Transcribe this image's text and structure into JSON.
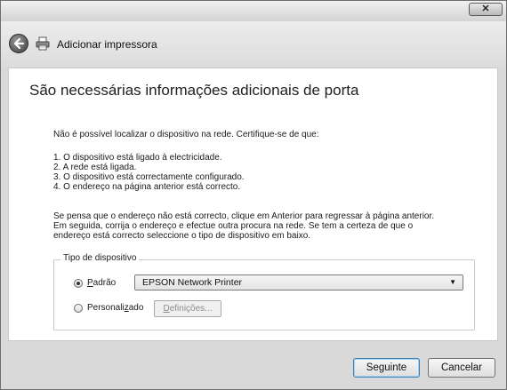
{
  "window": {
    "title": "Adicionar impressora",
    "close_label": "✕"
  },
  "page": {
    "heading": "São necessárias informações adicionais de porta",
    "not_found": "Não é possível localizar o dispositivo na rede. Certifique-se de que:",
    "checklist": [
      "1. O dispositivo está ligado à electricidade.",
      "2. A rede está ligada.",
      "3. O dispositivo está correctamente configurado.",
      "4. O endereço na página anterior está correcto."
    ],
    "hint_lines": [
      "Se pensa que o endereço não está correcto, clique em Anterior para regressar à página anterior.",
      "Em seguida, corrija o endereço e efectue outra procura na rede. Se tem a certeza de que o",
      "endereço está correcto seleccione o tipo de dispositivo em baixo."
    ]
  },
  "device_type": {
    "group_label": "Tipo de dispositivo",
    "standard": {
      "accel": "P",
      "rest": "adrão",
      "checked": true
    },
    "custom": {
      "before": "Personali",
      "accel": "z",
      "after": "ado",
      "checked": false
    },
    "standard_selected": "EPSON Network Printer",
    "settings_button": {
      "accel": "D",
      "rest": "efinições...",
      "enabled": false
    }
  },
  "footer": {
    "next_label": "Seguinte",
    "cancel_label": "Cancelar"
  }
}
